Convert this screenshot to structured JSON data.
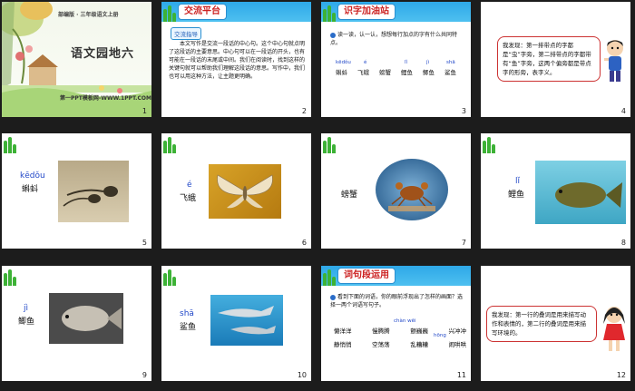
{
  "slides": [
    {
      "num": "1",
      "banner": "部编版 · 三年级语文上册",
      "title": "语文园地六",
      "footer": "第一PPT模板网-WWW.1PPT.COM"
    },
    {
      "num": "2",
      "header": "交流平台",
      "subheader": "交流指导",
      "text": "本文写作是交流一段话的中心句。这个中心句就点明了这段话的主要意思。中心句可以在一段话的开头，也有可能在一段话的末尾或中间。我们在阅读时，找到这样的关键句就可以帮助我们理解这段话的意思。写作中，我们也可以用这种方法，让主题更明确。"
    },
    {
      "num": "3",
      "header": "识字加油站",
      "instruction": "读一读，认一认，想想每行加点的字有什么共同特点。",
      "words": [
        {
          "pinyin": "kēdǒu",
          "word": "蝌蚪"
        },
        {
          "pinyin": "é",
          "word": "飞蛾"
        },
        {
          "pinyin": "",
          "word": "螃蟹"
        },
        {
          "pinyin": "lǐ",
          "word": "鲤鱼"
        },
        {
          "pinyin": "jì",
          "word": "鲫鱼"
        },
        {
          "pinyin": "shā",
          "word": "鲨鱼"
        }
      ]
    },
    {
      "num": "4",
      "bubble": "我发现：第一排带点的字都是“虫”字旁，第二排带点的字都带有“鱼”字旁，这两个偏旁都是带点字的形旁，表字义。"
    },
    {
      "num": "5",
      "pinyin": "kēdǒu",
      "label": "蝌蚪"
    },
    {
      "num": "6",
      "pinyin": "é",
      "label": "飞蛾"
    },
    {
      "num": "7",
      "pinyin": "",
      "label": "螃蟹"
    },
    {
      "num": "8",
      "pinyin": "lǐ",
      "label": "鲤鱼"
    },
    {
      "num": "9",
      "pinyin": "jì",
      "label": "鲫鱼"
    },
    {
      "num": "10",
      "pinyin": "shā",
      "label": "鲨鱼"
    },
    {
      "num": "11",
      "header": "词句段运用",
      "instruction": "看到下面的词语，你的眼前浮现出了怎样的画面？选择一两个词语写句子。",
      "row1": [
        "懒洋洋",
        "慢腾腾",
        "颤巍巍",
        "兴冲冲"
      ],
      "row1_pinyin": "chàn wēi",
      "row2": [
        "静悄悄",
        "空荡荡",
        "乱糟糟",
        "闹哄哄"
      ],
      "row2_pinyin": "hōng"
    },
    {
      "num": "12",
      "bubble": "我发现：第一行的叠词是用来描写动作和表情的，第二行的叠词是用来描写环境的。"
    }
  ]
}
